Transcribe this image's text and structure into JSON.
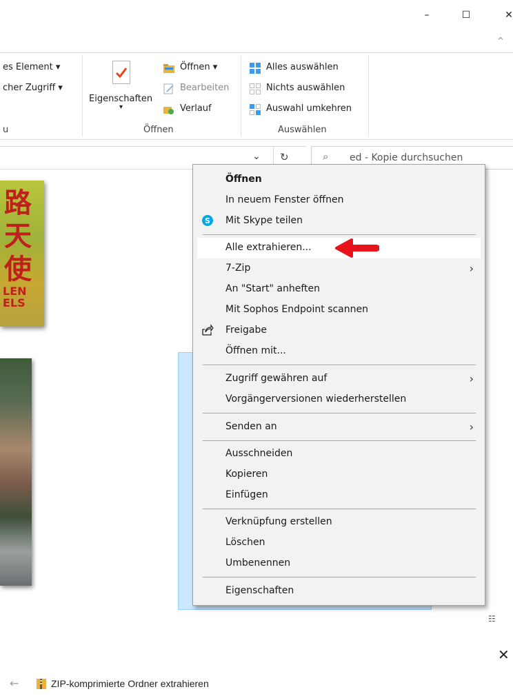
{
  "window": {
    "minimize_glyph": "–",
    "maximize_glyph": "☐",
    "close_glyph": "✕",
    "ribbon_collapse_glyph": "^"
  },
  "ribbon": {
    "left_partial": {
      "item1": "es Element ▾",
      "item2": "cher Zugriff ▾",
      "group_partial": "u"
    },
    "properties_label": "Eigenschaften",
    "properties_dropdown": "▾",
    "open_group": {
      "open": "Öffnen ▾",
      "edit": "Bearbeiten",
      "history": "Verlauf",
      "label": "Öffnen"
    },
    "select_group": {
      "select_all": "Alles auswählen",
      "select_none": "Nichts auswählen",
      "invert": "Auswahl umkehren",
      "label": "Auswählen"
    }
  },
  "address": {
    "dropdown_glyph": "⌄",
    "refresh_glyph": "↻",
    "search_placeholder": "ed - Kopie durchsuchen"
  },
  "thumb_text": {
    "t1": "路",
    "t2": "天",
    "t3": "使",
    "t4": "LEN",
    "t5": "ELS"
  },
  "context_menu": {
    "open": "Öffnen",
    "open_new_window": "In neuem Fenster öffnen",
    "skype": "Mit Skype teilen",
    "extract_all": "Alle extrahieren...",
    "seven_zip": "7-Zip",
    "pin_start": "An \"Start\" anheften",
    "sophos": "Mit Sophos Endpoint scannen",
    "share": "Freigabe",
    "open_with": "Öffnen mit...",
    "give_access": "Zugriff gewähren auf",
    "restore_prev": "Vorgängerversionen wiederherstellen",
    "send_to": "Senden an",
    "cut": "Ausschneiden",
    "copy": "Kopieren",
    "paste": "Einfügen",
    "create_shortcut": "Verknüpfung erstellen",
    "delete": "Löschen",
    "rename": "Umbenennen",
    "properties": "Eigenschaften",
    "submenu_arrow": "›"
  },
  "colors": {
    "highlight_arrow": "#e8141c",
    "selection_fill": "#cce8ff",
    "skype_blue": "#00a8e6"
  },
  "bottom": {
    "close_glyph": "✕",
    "back_glyph": "←",
    "dialog_title": "ZIP-komprimierte Ordner extrahieren"
  },
  "statusbar": {
    "view_icons": "☷"
  }
}
